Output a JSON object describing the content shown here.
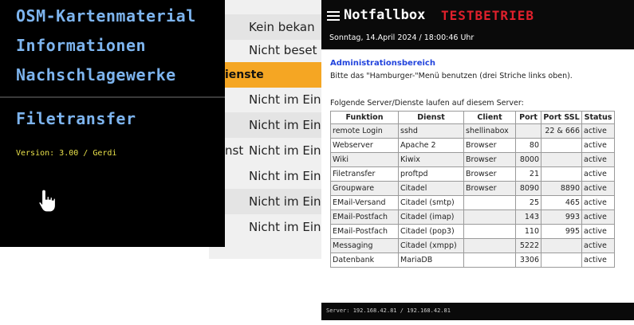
{
  "background_list": {
    "items": [
      {
        "label": "Kein bekan",
        "style": "alt"
      },
      {
        "label": "Nicht beset",
        "style": "plain"
      },
      {
        "label": "ienste",
        "style": "hl"
      },
      {
        "label": "Nicht im Ein",
        "style": "plain"
      },
      {
        "label": "Nicht im Ein",
        "style": "alt"
      },
      {
        "label": "Nicht im Ein",
        "style": "plain"
      },
      {
        "label": "Nicht im Ein",
        "style": "plain"
      },
      {
        "label": "Nicht im Ein",
        "style": "alt"
      },
      {
        "label": "Nicht im Ein",
        "style": "plain"
      }
    ],
    "edge_fragment": "nst"
  },
  "left_menu": {
    "items": [
      "OSM-Kartenmaterial",
      "Informationen",
      "Nachschlagewerke"
    ],
    "filetransfer": "Filetransfer",
    "version": "Version: 3.00 / Gerdi",
    "cursor_icon": "hand-pointer-icon"
  },
  "header": {
    "menu_icon": "hamburger-menu-icon",
    "title": "Notfallbox",
    "mode": "TESTBETRIEB",
    "mode_color": "#e0202c",
    "date": "Sonntag, 14.April 2024 / 18:00:46 Uhr"
  },
  "content": {
    "admin_title": "Administrationsbereich",
    "admin_hint": "Bitte das \"Hamburger-\"Menü benutzen (drei Striche links oben).",
    "servers_intro": "Folgende Server/Dienste laufen auf diesem Server:"
  },
  "table": {
    "headers": [
      "Funktion",
      "Dienst",
      "Client",
      "Port",
      "Port SSL",
      "Status"
    ],
    "rows": [
      [
        "remote Login",
        "sshd",
        "shellinabox",
        "",
        "22 & 666",
        "active"
      ],
      [
        "Webserver",
        "Apache 2",
        "Browser",
        "80",
        "",
        "active"
      ],
      [
        "Wiki",
        "Kiwix",
        "Browser",
        "8000",
        "",
        "active"
      ],
      [
        "Filetransfer",
        "proftpd",
        "Browser",
        "21",
        "",
        "active"
      ],
      [
        "Groupware",
        "Citadel",
        "Browser",
        "8090",
        "8890",
        "active"
      ],
      [
        "EMail-Versand",
        "Citadel (smtp)",
        "",
        "25",
        "465",
        "active"
      ],
      [
        "EMail-Postfach",
        "Citadel (imap)",
        "",
        "143",
        "993",
        "active"
      ],
      [
        "EMail-Postfach",
        "Citadel (pop3)",
        "",
        "110",
        "995",
        "active"
      ],
      [
        "Messaging",
        "Citadel (xmpp)",
        "",
        "5222",
        "",
        "active"
      ],
      [
        "Datenbank",
        "MariaDB",
        "",
        "3306",
        "",
        "active"
      ]
    ]
  },
  "footer": {
    "server_ip": "Server: 192.168.42.81 / 192.168.42.81"
  }
}
